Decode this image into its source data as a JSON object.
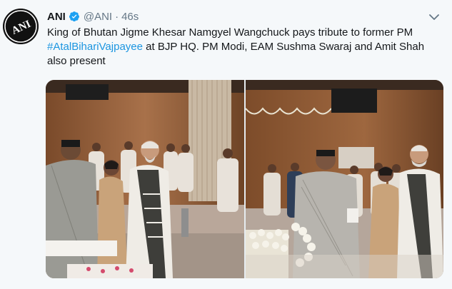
{
  "tweet": {
    "avatar_label": "ANI",
    "display_name": "ANI",
    "handle": "@ANI",
    "separator": "·",
    "time": "46s",
    "text_part1": "King of Bhutan Jigme Khesar Namgyel Wangchuck pays tribute to former PM",
    "hashtag": "#AtalBihariVajpayee",
    "text_part2": "at BJP HQ. PM Modi, EAM Sushma Swaraj and Amit Shah also present",
    "photos": [
      {
        "name": "photo-left"
      },
      {
        "name": "photo-right"
      }
    ]
  },
  "colors": {
    "link": "#1b95e0",
    "verified": "#1da1f2",
    "meta": "#657786",
    "text": "#14171a"
  },
  "icons": {
    "verified": "verified-badge-icon",
    "caret": "chevron-down-icon"
  }
}
